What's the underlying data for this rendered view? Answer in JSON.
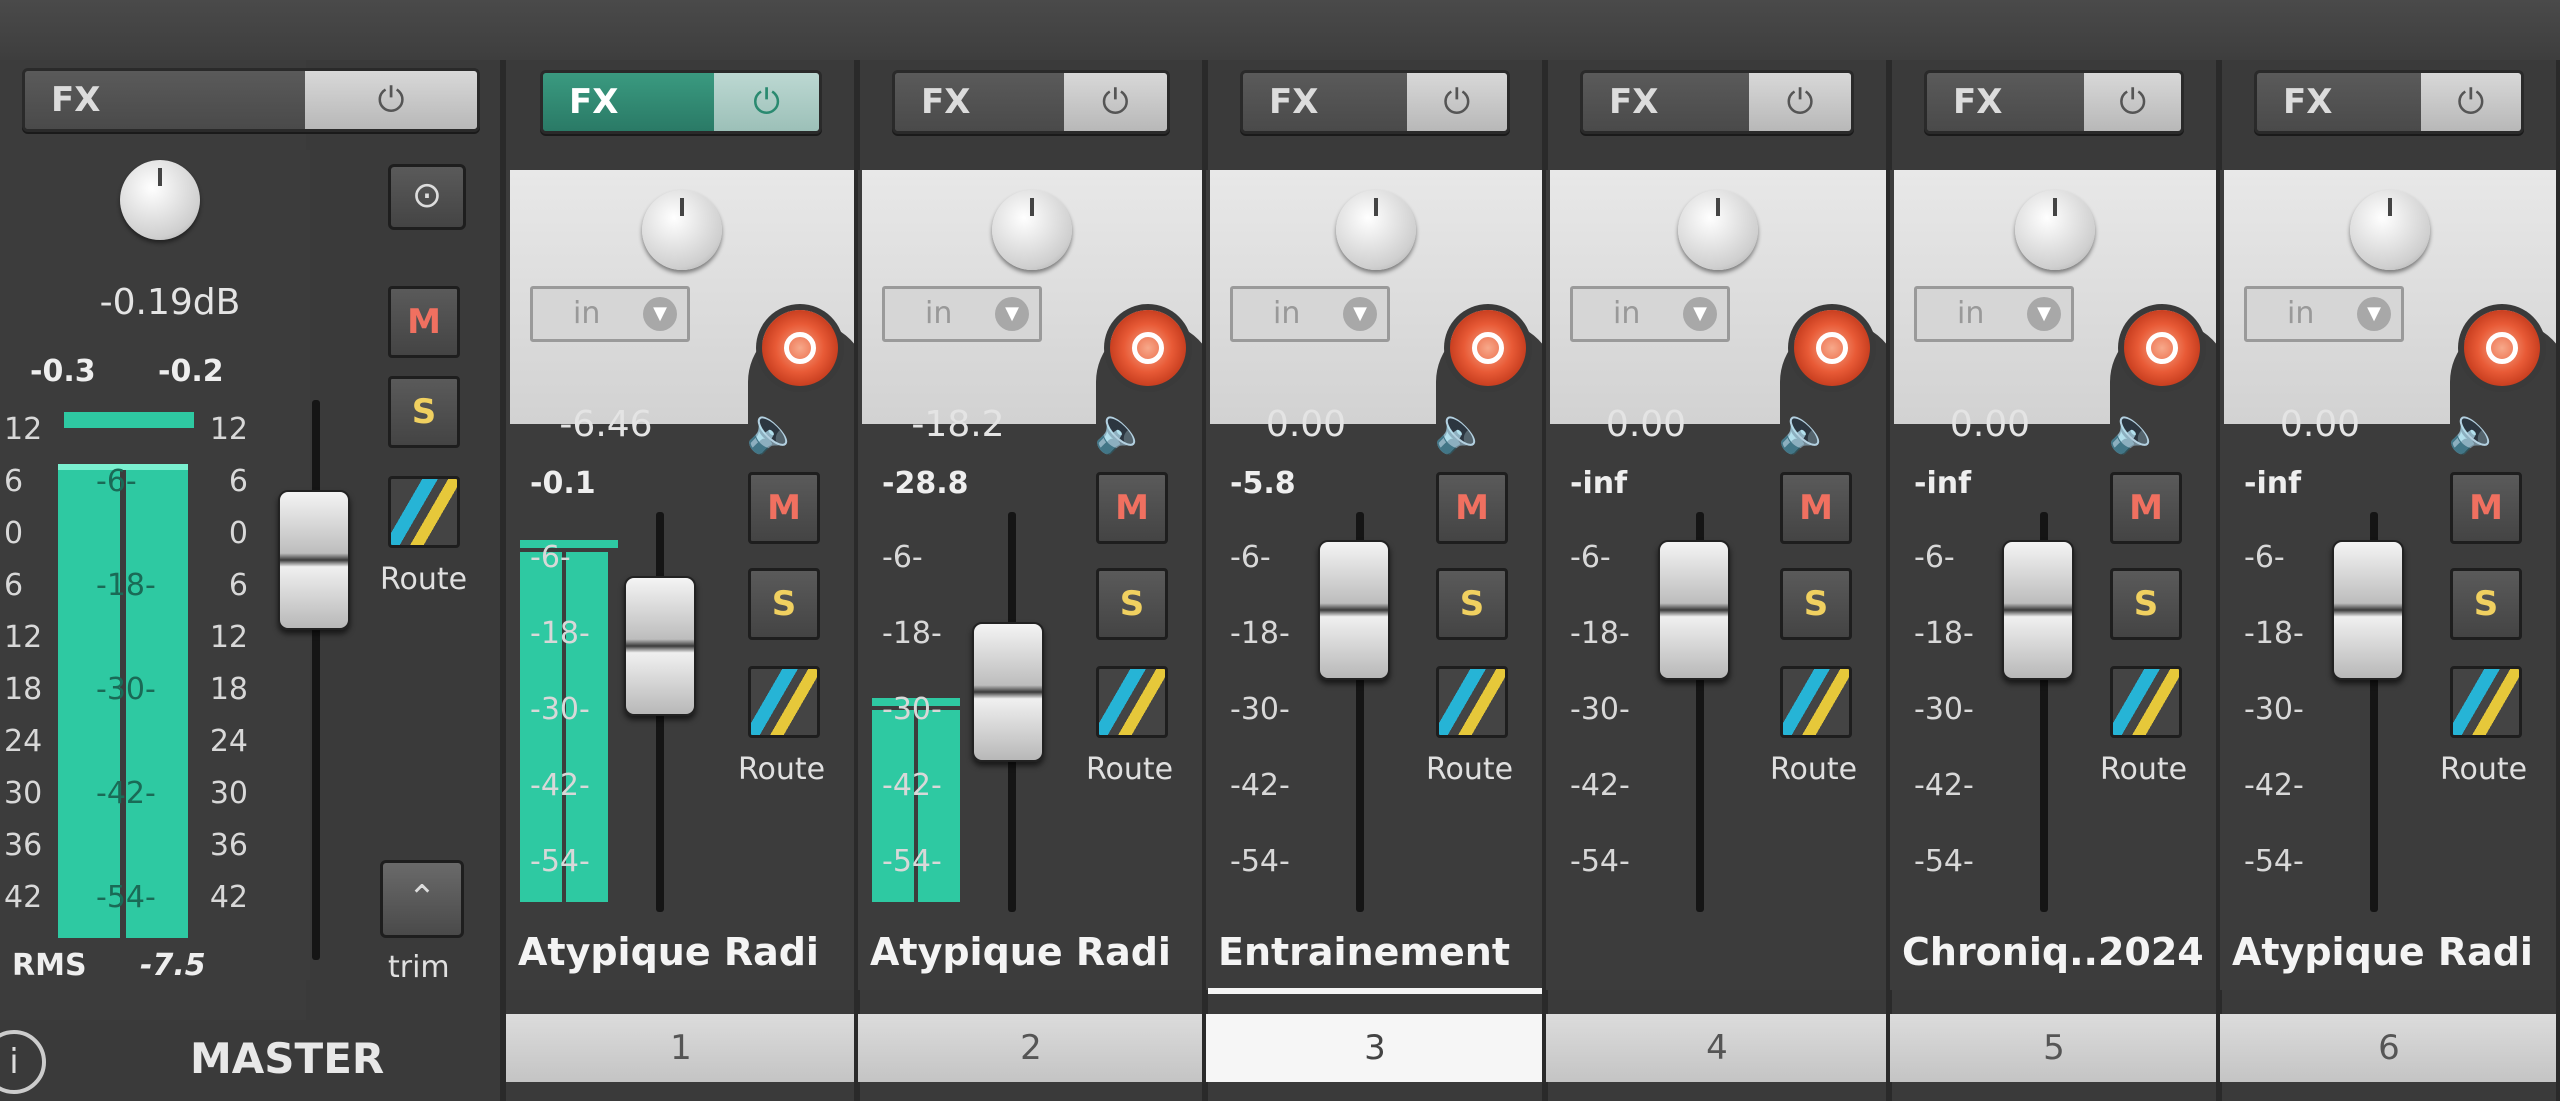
{
  "master": {
    "fx_label": "FX",
    "power_icon": "power-icon",
    "volume": "-0.19dB",
    "peak_left": "-0.3",
    "peak_right": "-0.2",
    "scale_left": [
      "12",
      "6",
      "0",
      "6",
      "12",
      "18",
      "24",
      "30",
      "36",
      "42"
    ],
    "scale_center": [
      "-6-",
      "-18-",
      "-30-",
      "-42-",
      "-54-"
    ],
    "scale_right": [
      "12",
      "6",
      "0",
      "6",
      "12",
      "18",
      "24",
      "30",
      "36",
      "42"
    ],
    "rms_label": "RMS",
    "rms_value": "-7.5",
    "mute_label": "M",
    "solo_label": "S",
    "route_label": "Route",
    "trim_label": "trim",
    "name": "MASTER",
    "info_label": "i"
  },
  "channels": [
    {
      "number": "1",
      "name": "Atypique Radi",
      "volume": "-6.46",
      "peak": "-0.1",
      "fx_active": true
    },
    {
      "number": "2",
      "name": "Atypique Radi",
      "volume": "-18.2",
      "peak": "-28.8",
      "fx_active": false
    },
    {
      "number": "3",
      "name": "Entrainement",
      "volume": "0.00",
      "peak": "-5.8",
      "fx_active": false
    },
    {
      "number": "4",
      "name": "",
      "volume": "0.00",
      "peak": "-inf",
      "fx_active": false
    },
    {
      "number": "5",
      "name": "Chroniq..2024",
      "volume": "0.00",
      "peak": "-inf",
      "fx_active": false
    },
    {
      "number": "6",
      "name": "Atypique Radi",
      "volume": "0.00",
      "peak": "-inf",
      "fx_active": false
    }
  ],
  "channel_common": {
    "fx_label": "FX",
    "input_label": "in",
    "mute_label": "M",
    "solo_label": "S",
    "route_label": "Route",
    "scale": [
      "-6-",
      "-18-",
      "-30-",
      "-42-",
      "-54-"
    ]
  },
  "colors": {
    "meter": "#2ec9a2",
    "record": "#e85a36",
    "mute": "#f07060",
    "solo": "#f0d060"
  }
}
